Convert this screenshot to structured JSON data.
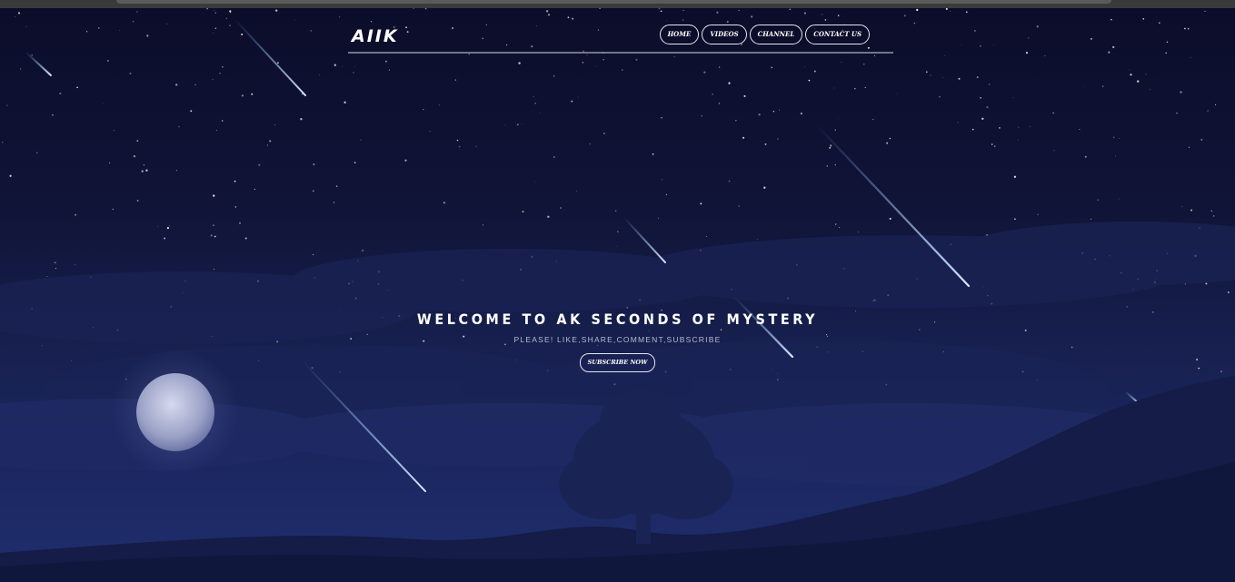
{
  "site": {
    "logo": "AIIK"
  },
  "nav": {
    "links": [
      "HOME",
      "VIDEOS",
      "CHANNEL",
      "CONTACT US"
    ]
  },
  "hero": {
    "headline": "WELCOME TO AK SECONDS OF MYSTERY",
    "subline": "PLEASE! LIKE,SHARE,COMMENT,SUBSCRIBE",
    "cta_label": "SUBSCRIBE NOW",
    "colors": {
      "sky_top": "#0b0d2a",
      "sky_bottom": "#1f2e6e",
      "moon": "#c9cde6",
      "meteor": "#7fb6ff"
    },
    "icons": [
      "moon-illustration",
      "meteor-streaks",
      "tree-silhouette",
      "hill-silhouette"
    ]
  }
}
